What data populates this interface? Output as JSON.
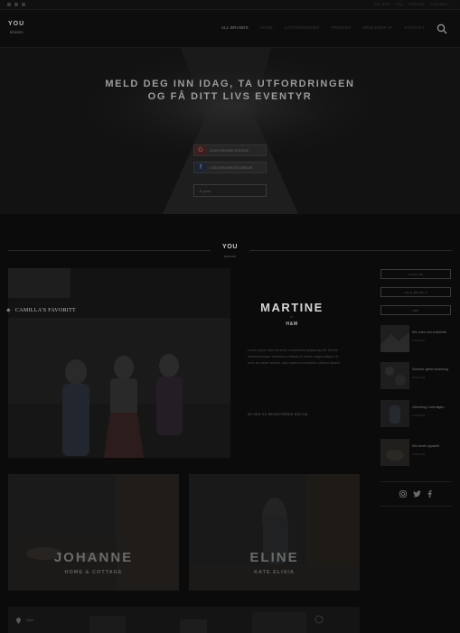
{
  "topbar": {
    "social_icons": [
      "facebook-icon",
      "instagram-icon",
      "twitter-icon"
    ],
    "links": [
      "OM OSS",
      "FAQ",
      "PRESSE",
      "KONTAKT"
    ]
  },
  "header": {
    "logo": "YOU",
    "logo_sub": "BRANDS",
    "nav": [
      {
        "label": "ALL BRANDS",
        "active": true
      },
      {
        "label": "HOME",
        "active": false
      },
      {
        "label": "UTFORDRINGER",
        "active": false
      },
      {
        "label": "PREMIER",
        "active": false
      },
      {
        "label": "MEDLEMSKAP",
        "active": false
      },
      {
        "label": "KONTAKT",
        "active": false
      }
    ]
  },
  "hero": {
    "title_line1": "MELD DEG INN IDAG, TA UTFORDRINGEN",
    "title_line2": "OG FÅ DITT LIVS EVENTYR",
    "google_label": "LOGG INN MED GOOGLE",
    "facebook_label": "LOGG INN MED FACEBOOK",
    "email_placeholder": "E-post"
  },
  "section": {
    "title": "YOU",
    "subtitle": "BRANDS"
  },
  "featured": {
    "label": "CAMILLA'S FAVORITT",
    "brand_name": "MARTINE",
    "brand_by": "BY",
    "brand_company": "H&M",
    "description": "Lorem ipsum dolor sit amet, consectetur adipiscing elit. Sed do eiusmod tempor incididunt ut labore et dolore magna aliqua. Ut enim ad minim veniam, quis nostrud exercitation ullamco laboris.",
    "link": "SE HER OG REGISTRERER DEG NÅ"
  },
  "cards": [
    {
      "name": "JOHANNE",
      "sub": "HOME & COTTAGE"
    },
    {
      "name": "ELINE",
      "sub": "KATE ELIXIA"
    }
  ],
  "sidebar": {
    "buttons": [
      "LOGG INN",
      "VELG BRAND ▾",
      "SØK"
    ],
    "posts": [
      {
        "title": "Min reise mot et fjellmål",
        "date": "1 JUNI 2016"
      },
      {
        "title": "Sommer glede bookskog",
        "date": "28 MAI 2016"
      },
      {
        "title": "Utfordring i hverdagen",
        "date": "21 MAI 2016"
      },
      {
        "title": "Min beste oppskrift",
        "date": "14 MAI 2016"
      }
    ],
    "social": [
      "instagram-icon",
      "twitter-icon",
      "facebook-icon"
    ]
  },
  "banner": {
    "label": "Oslo"
  }
}
